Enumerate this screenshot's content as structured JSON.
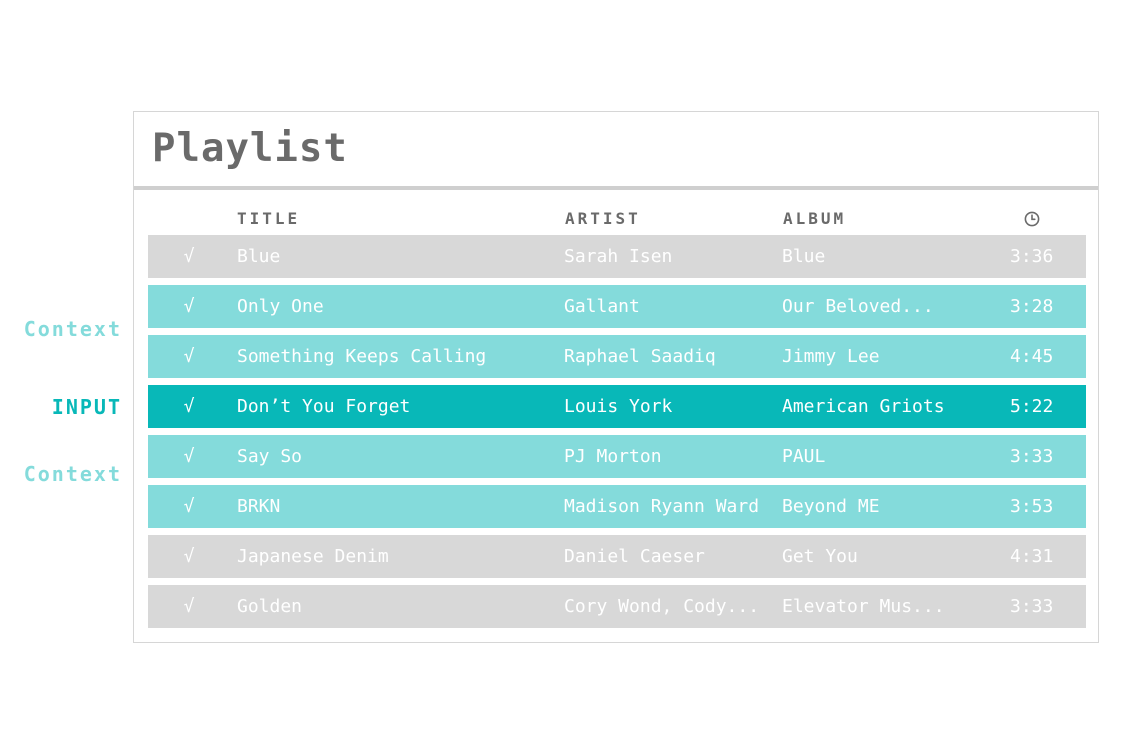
{
  "annotations": {
    "context_top": "Context",
    "input": "INPUT",
    "context_bottom": "Context"
  },
  "playlist": {
    "title": "Playlist",
    "columns": {
      "title": "TITLE",
      "artist": "ARTIST",
      "album": "ALBUM",
      "duration_icon": "clock-icon"
    },
    "rows": [
      {
        "check": "√",
        "title": "Blue",
        "artist": "Sarah Isen",
        "album": "Blue",
        "duration": "3:36",
        "state": "gray"
      },
      {
        "check": "√",
        "title": "Only One",
        "artist": "Gallant",
        "album": "Our Beloved...",
        "duration": "3:28",
        "state": "context"
      },
      {
        "check": "√",
        "title": "Something Keeps Calling",
        "artist": "Raphael Saadiq",
        "album": "Jimmy Lee",
        "duration": "4:45",
        "state": "context"
      },
      {
        "check": "√",
        "title": "Don’t You Forget",
        "artist": "Louis York",
        "album": "American Griots",
        "duration": "5:22",
        "state": "input"
      },
      {
        "check": "√",
        "title": "Say So",
        "artist": "PJ Morton",
        "album": "PAUL",
        "duration": "3:33",
        "state": "context"
      },
      {
        "check": "√",
        "title": "BRKN",
        "artist": "Madison Ryann Ward",
        "album": "Beyond ME",
        "duration": "3:53",
        "state": "context"
      },
      {
        "check": "√",
        "title": "Japanese Denim",
        "artist": "Daniel Caeser",
        "album": "Get You",
        "duration": "4:31",
        "state": "gray"
      },
      {
        "check": "√",
        "title": "Golden",
        "artist": "Cory Wond, Cody...",
        "album": "Elevator Mus...",
        "duration": "3:33",
        "state": "gray"
      }
    ]
  },
  "colors": {
    "gray_row": "#d8d8d8",
    "context_row": "#84dbdb",
    "input_row": "#08b8b8",
    "header_text": "#6a6a6a"
  }
}
